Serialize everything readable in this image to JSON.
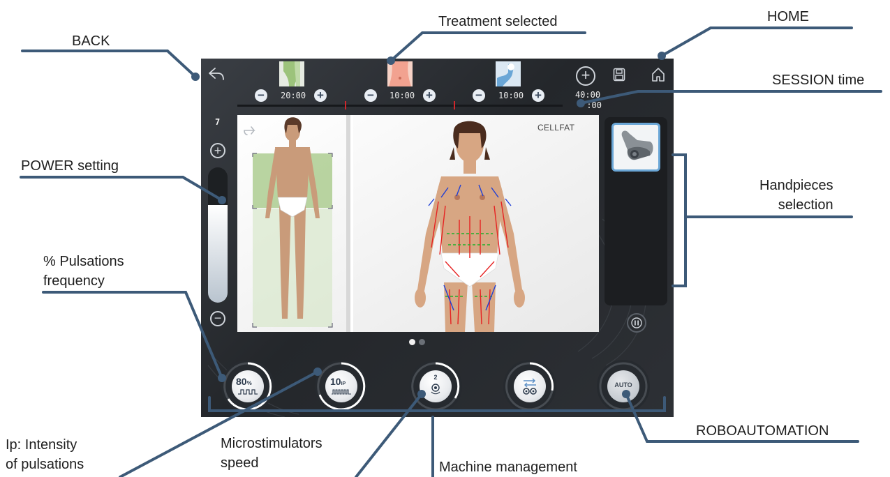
{
  "callouts": {
    "back": "BACK",
    "treatment_selected": "Treatment selected",
    "home": "HOME",
    "session_time": "SESSION time",
    "power_setting": "POWER setting",
    "handpieces_line1": "Handpieces",
    "handpieces_line2": "selection",
    "pulsations_line1": "% Pulsations",
    "pulsations_line2": "frequency",
    "ip_line1": "Ip: Intensity",
    "ip_line2": "of pulsations",
    "micro_line1": "Microstimulators",
    "micro_line2": "speed",
    "machine_management": "Machine management",
    "roboautomation": "ROBOAUTOMATION"
  },
  "device": {
    "treatments": [
      {
        "time": "20:00",
        "icon": "leg-area-thumbnail-icon",
        "color": "#9cc37b"
      },
      {
        "time": "10:00",
        "icon": "abdomen-area-thumbnail-icon",
        "color": "#f2a290"
      },
      {
        "time": "10:00",
        "icon": "arm-area-thumbnail-icon",
        "color": "#6aa6d6"
      }
    ],
    "session_time_line1": "40:00",
    "session_time_line2": ":00",
    "power_value": "7",
    "power_level": 0.72,
    "treatment_name": "CELLFAT",
    "page_indicator": {
      "count": 2,
      "active": 0
    },
    "knobs": [
      {
        "main": "80",
        "unit": "%",
        "icon": "pulse-square-wave-icon"
      },
      {
        "main": "10",
        "unit": "IP",
        "icon": "pulse-train-icon"
      },
      {
        "main": "2",
        "unit": "",
        "icon": "rotation-speed-icon"
      },
      {
        "main": "",
        "unit": "",
        "icon": "transfer-arrows-icon"
      },
      {
        "main": "AUTO",
        "unit": "",
        "icon": "auto-icon"
      }
    ]
  },
  "colors": {
    "device_bg": "#2b2e33",
    "callout_line": "#3d5a78",
    "accent_red": "#d0262b",
    "leg_zone": "#9cc37b"
  }
}
